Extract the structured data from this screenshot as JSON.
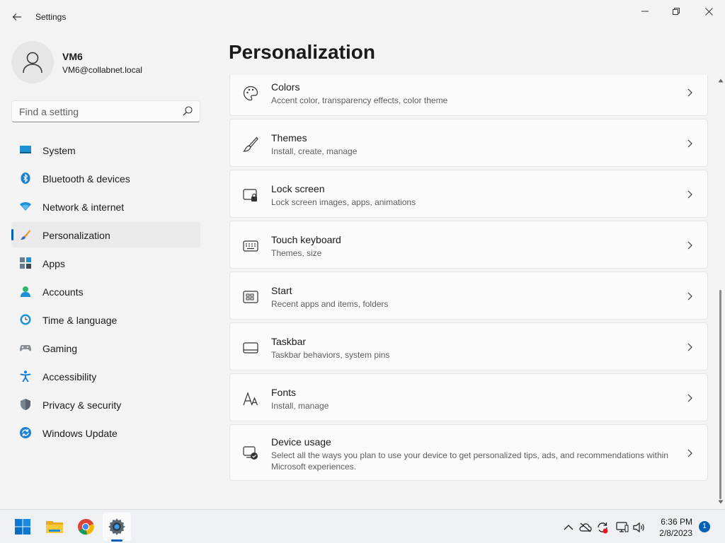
{
  "window": {
    "title": "Settings"
  },
  "user": {
    "name": "VM6",
    "email": "VM6@collabnet.local"
  },
  "search": {
    "placeholder": "Find a setting"
  },
  "nav": [
    {
      "label": "System",
      "icon": "system-icon"
    },
    {
      "label": "Bluetooth & devices",
      "icon": "bluetooth-icon"
    },
    {
      "label": "Network & internet",
      "icon": "network-icon"
    },
    {
      "label": "Personalization",
      "icon": "personalization-icon",
      "active": true
    },
    {
      "label": "Apps",
      "icon": "apps-icon"
    },
    {
      "label": "Accounts",
      "icon": "accounts-icon"
    },
    {
      "label": "Time & language",
      "icon": "time-language-icon"
    },
    {
      "label": "Gaming",
      "icon": "gaming-icon"
    },
    {
      "label": "Accessibility",
      "icon": "accessibility-icon"
    },
    {
      "label": "Privacy & security",
      "icon": "privacy-security-icon"
    },
    {
      "label": "Windows Update",
      "icon": "windows-update-icon"
    }
  ],
  "page": {
    "title": "Personalization"
  },
  "cards": [
    {
      "title": "Colors",
      "desc": "Accent color, transparency effects, color theme",
      "icon": "palette-icon"
    },
    {
      "title": "Themes",
      "desc": "Install, create, manage",
      "icon": "brush-icon"
    },
    {
      "title": "Lock screen",
      "desc": "Lock screen images, apps, animations",
      "icon": "lock-screen-icon"
    },
    {
      "title": "Touch keyboard",
      "desc": "Themes, size",
      "icon": "keyboard-icon"
    },
    {
      "title": "Start",
      "desc": "Recent apps and items, folders",
      "icon": "start-icon"
    },
    {
      "title": "Taskbar",
      "desc": "Taskbar behaviors, system pins",
      "icon": "taskbar-icon"
    },
    {
      "title": "Fonts",
      "desc": "Install, manage",
      "icon": "fonts-icon"
    },
    {
      "title": "Device usage",
      "desc": "Select all the ways you plan to use your device to get personalized tips, ads, and recommendations within Microsoft experiences.",
      "icon": "device-usage-icon"
    }
  ],
  "taskbar": {
    "apps": [
      "windows-start-icon",
      "file-explorer-icon",
      "chrome-icon",
      "settings-icon"
    ],
    "tray": [
      "chevron-up-icon",
      "onedrive-icon",
      "sync-icon",
      "display-icon",
      "volume-icon"
    ],
    "time": "6:36 PM",
    "date": "2/8/2023",
    "notification_count": "1"
  },
  "colors": {
    "accent": "#005fb8",
    "background": "#f3f3f3",
    "card": "#fbfbfb"
  }
}
